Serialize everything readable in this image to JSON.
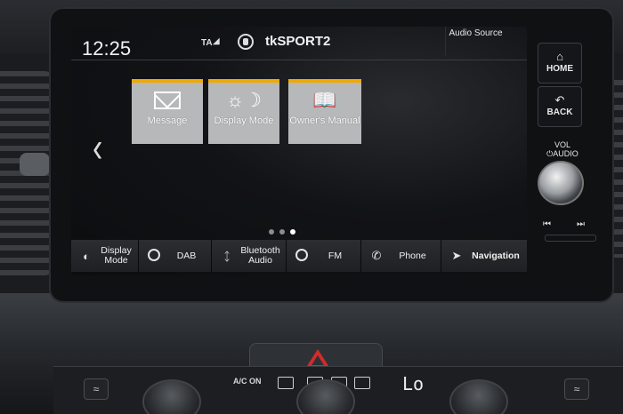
{
  "status_bar": {
    "clock": "12:25",
    "traffic_announcement": "TA",
    "station": "tkSPORT2",
    "audio_source_label": "Audio Source"
  },
  "tiles": [
    {
      "label": "Message",
      "icon": "envelope-icon"
    },
    {
      "label": "Display Mode",
      "icon": "sun-moon-icon"
    },
    {
      "label": "Owner's Manual",
      "icon": "book-info-icon"
    }
  ],
  "pager": {
    "page_count": 3,
    "active_page": 3
  },
  "shortcuts": [
    {
      "label": "Display Mode",
      "icon": "display-mode-icon"
    },
    {
      "label": "DAB",
      "icon": "radio-icon"
    },
    {
      "label": "Bluetooth Audio",
      "icon": "bluetooth-icon"
    },
    {
      "label": "FM",
      "icon": "radio-icon"
    },
    {
      "label": "Phone",
      "icon": "phone-icon"
    },
    {
      "label": "Navigation",
      "icon": "navigation-icon"
    }
  ],
  "hardware": {
    "home_label": "HOME",
    "back_label": "BACK",
    "vol_label": "VOL",
    "audio_label": "AUDIO"
  },
  "climate": {
    "ac_label": "A/C ON",
    "temperature": "Lo"
  },
  "colors": {
    "tile_accent": "#f0a900",
    "tile_background": "#b6b8b9",
    "hazard": "#d22b2b"
  }
}
